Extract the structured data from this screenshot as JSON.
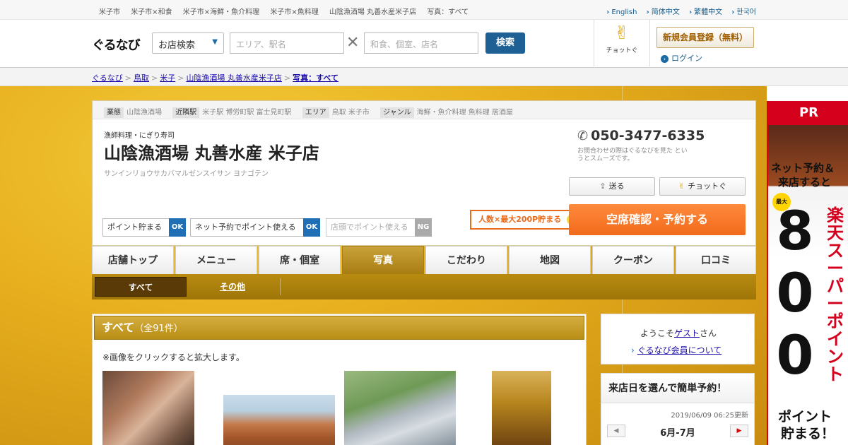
{
  "topbar": {
    "crumbs": [
      "米子市",
      "米子市×和食",
      "米子市×海鮮・魚介料理",
      "米子市×魚料理",
      "山陰漁酒場 丸善水産米子店",
      "写真：すべて"
    ],
    "langs": [
      "English",
      "简体中文",
      "繁體中文",
      "한국어"
    ]
  },
  "header": {
    "logo": "ぐるなび",
    "search_mode": "お店検索",
    "area_placeholder": "エリア、駅名",
    "keyword_placeholder": "和食、個室、店名",
    "search_label": "検索",
    "chotto_label": "チョットぐ",
    "register_label": "新規会員登録（無料）",
    "login_label": "ログイン"
  },
  "breadcrumb": {
    "items": [
      "ぐるなび",
      "鳥取",
      "米子",
      "山陰漁酒場 丸善水産米子店"
    ],
    "current": "写真：すべて"
  },
  "shop": {
    "tags": [
      {
        "key": "業態",
        "value": "山陰漁酒場"
      },
      {
        "key": "近隣駅",
        "value": "米子駅 博労町駅 富士見町駅"
      },
      {
        "key": "エリア",
        "value": "鳥取 米子市"
      },
      {
        "key": "ジャンル",
        "value": "海鮮・魚介料理 魚料理 居酒屋"
      }
    ],
    "subtitle": "漁師料理・にぎり寿司",
    "name": "山陰漁酒場 丸善水産 米子店",
    "kana": "サンインリョウサカバマルゼンスイサン ヨナゴテン",
    "phone": "050-3477-6335",
    "phone_note": "お問合わせの際はぐるなびを見た というとスムーズです。",
    "send_label": "送る",
    "chotto_label": "チョットぐ",
    "points": [
      {
        "label": "ポイント貯まる",
        "status": "OK"
      },
      {
        "label": "ネット予約でポイント使える",
        "status": "OK"
      },
      {
        "label": "店頭でポイント使える",
        "status": "NG"
      }
    ],
    "promo": "人数×最大200P貯まる",
    "reserve_label": "空席確認・予約する"
  },
  "tabs": [
    "店舗トップ",
    "メニュー",
    "席・個室",
    "写真",
    "こだわり",
    "地図",
    "クーポン",
    "口コミ"
  ],
  "active_tab": "写真",
  "subtabs": {
    "all": "すべて",
    "other": "その他"
  },
  "photos": {
    "title": "すべて",
    "count": "（全91件）",
    "note": "※画像をクリックすると拡大します。"
  },
  "sidebar": {
    "welcome_prefix": "ようこそ",
    "guest": "ゲスト",
    "welcome_suffix": "さん",
    "member_link": "ぐるなび会員について",
    "calendar_title": "来店日を選んで簡単予約！",
    "updated": "2019/06/09 06:25更新",
    "month": "6月-7月"
  },
  "ad": {
    "pr": "PR",
    "line1": "ネット予約＆",
    "line2": "来店すると",
    "max": "最大",
    "number": "800",
    "vertical": "楽天スーパーポイント",
    "line3": "ポイント",
    "line4": "貯まる！"
  },
  "colors": {
    "gold": "#d9a91c",
    "accent_orange": "#f26a1b",
    "nav_blue": "#1e5f94",
    "ok_blue": "#1e6fb5",
    "ad_red": "#d4001c"
  }
}
